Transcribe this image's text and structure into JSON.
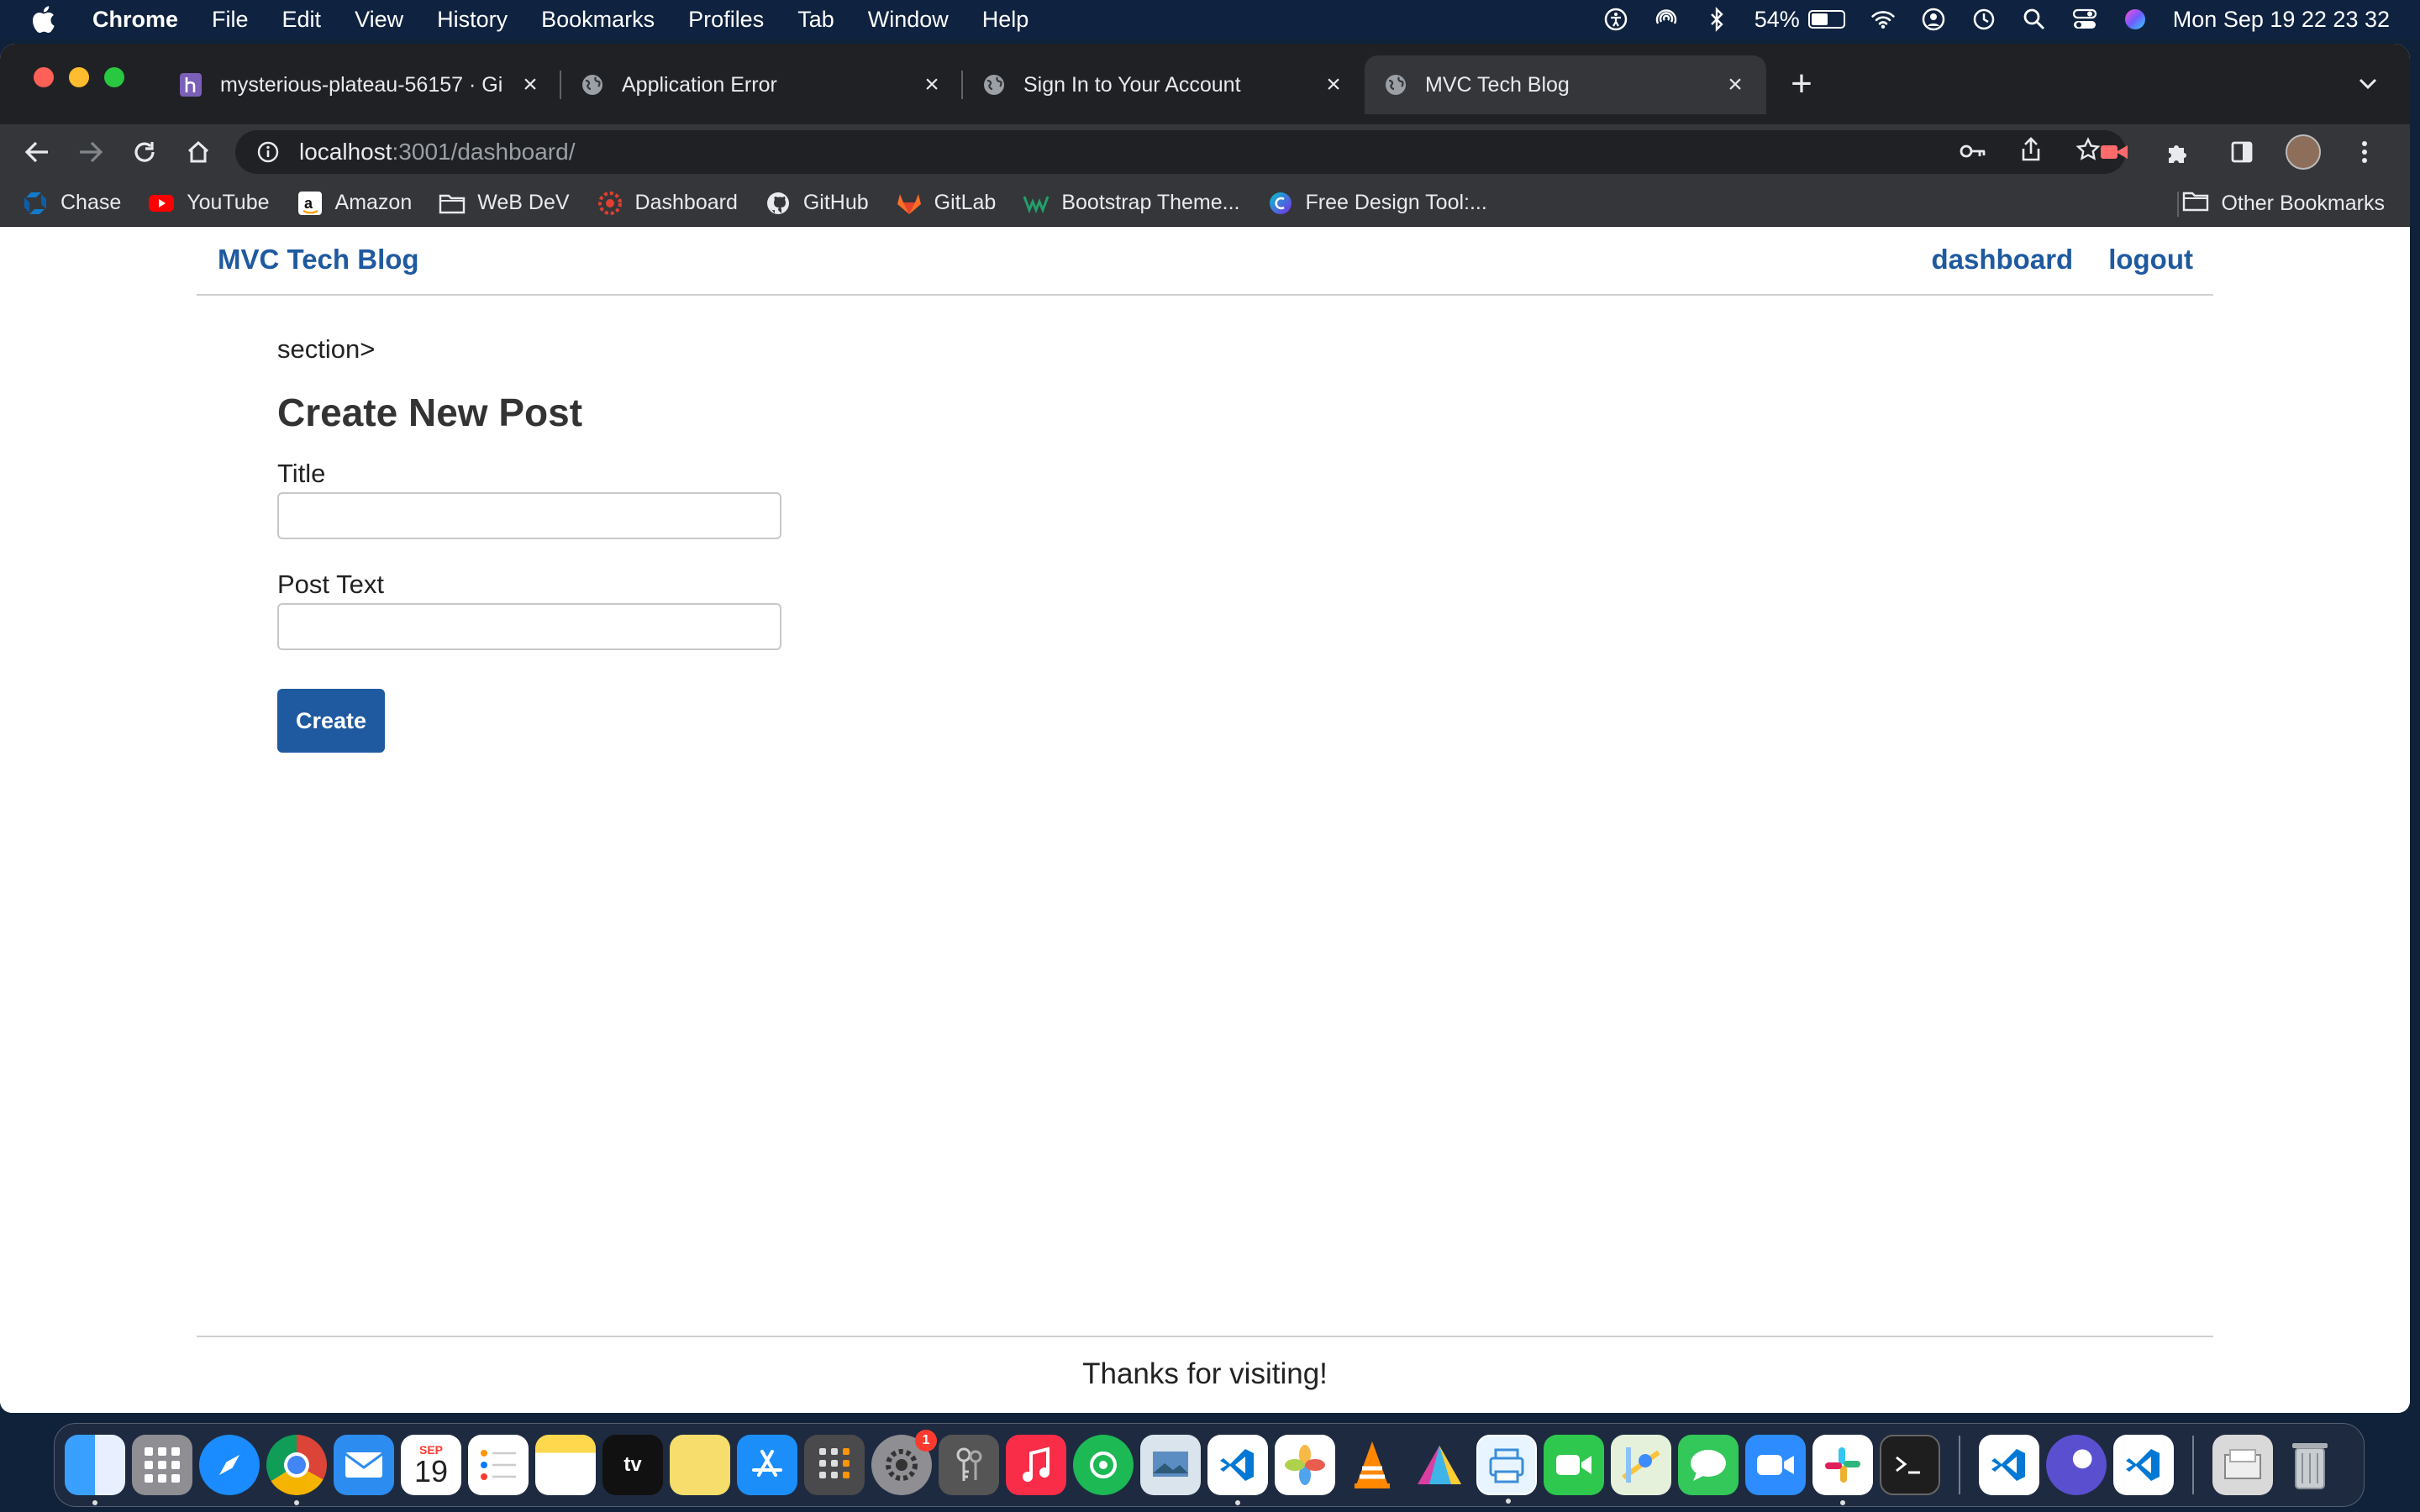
{
  "menubar": {
    "app_name": "Chrome",
    "items": [
      "File",
      "Edit",
      "View",
      "History",
      "Bookmarks",
      "Profiles",
      "Tab",
      "Window",
      "Help"
    ],
    "battery_percent": "54%",
    "battery_level": 0.54,
    "datetime": "Mon Sep 19  22 23 32"
  },
  "browser": {
    "tabs": [
      {
        "title": "mysterious-plateau-56157 · Gi",
        "icon": "heroku-icon",
        "active": false
      },
      {
        "title": "Application Error",
        "icon": "globe-icon",
        "active": false
      },
      {
        "title": "Sign In to Your Account",
        "icon": "globe-icon",
        "active": false
      },
      {
        "title": "MVC Tech Blog",
        "icon": "globe-icon",
        "active": true
      }
    ],
    "url_host": "localhost",
    "url_path": ":3001/dashboard/",
    "bookmarks": [
      {
        "label": "Chase",
        "icon": "chase-icon"
      },
      {
        "label": "YouTube",
        "icon": "youtube-icon"
      },
      {
        "label": "Amazon",
        "icon": "amazon-icon"
      },
      {
        "label": "WeB DeV",
        "icon": "folder-icon"
      },
      {
        "label": "Dashboard",
        "icon": "dashboard-icon"
      },
      {
        "label": "GitHub",
        "icon": "github-icon"
      },
      {
        "label": "GitLab",
        "icon": "gitlab-icon"
      },
      {
        "label": "Bootstrap Theme...",
        "icon": "wrapbootstrap-icon"
      },
      {
        "label": "Free Design Tool:...",
        "icon": "canva-icon"
      }
    ],
    "other_bookmarks": "Other Bookmarks"
  },
  "site": {
    "brand": "MVC Tech Blog",
    "nav": {
      "dashboard": "dashboard",
      "logout": "logout"
    },
    "stray_text": "section>",
    "page_title": "Create New Post",
    "form": {
      "title_label": "Title",
      "title_value": "",
      "body_label": "Post Text",
      "body_value": "",
      "submit_label": "Create"
    },
    "footer": "Thanks for visiting!"
  },
  "dock": {
    "calendar_month": "SEP",
    "calendar_day": "19",
    "settings_badge": "1"
  },
  "colors": {
    "brand": "#1f5aa0",
    "tab_bg": "#202124",
    "toolbar_bg": "#35363a"
  }
}
